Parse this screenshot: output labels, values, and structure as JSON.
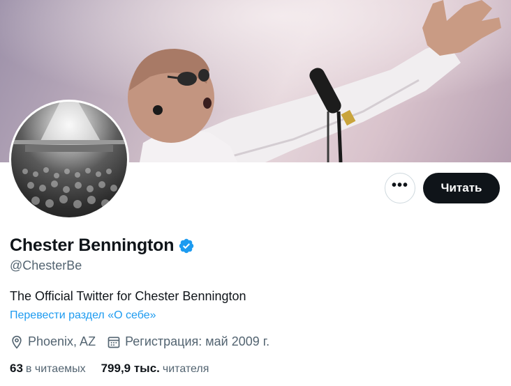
{
  "profile": {
    "display_name": "Chester Bennington",
    "handle": "@ChesterBe",
    "bio": "The Official Twitter for Chester Bennington",
    "translate_link": "Перевести раздел «О себе»",
    "location": "Phoenix, AZ",
    "joined": "Регистрация: май 2009 г.",
    "verified": true,
    "verified_color": "#1d9bf0"
  },
  "actions": {
    "more_label": "•••",
    "follow_label": "Читать"
  },
  "stats": {
    "following_count": "63",
    "following_label": "в читаемых",
    "followers_count": "799,9 тыс.",
    "followers_label": "читателя"
  },
  "icons": {
    "location": "map-pin-icon",
    "joined": "calendar-icon",
    "verified": "verified-badge-icon",
    "more": "more-dots-icon"
  }
}
